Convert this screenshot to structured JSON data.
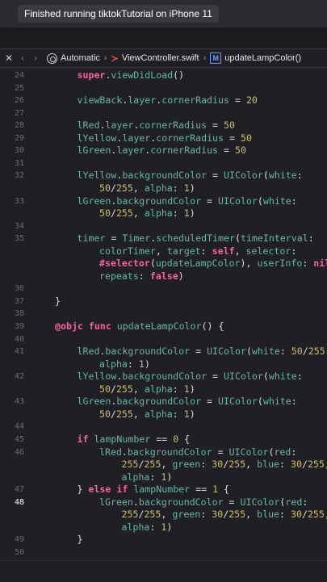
{
  "status": {
    "message": "Finished running tiktokTutorial on iPhone 11"
  },
  "jumpbar": {
    "close_glyph": "✕",
    "back_glyph": "‹",
    "forward_glyph": "›",
    "scheme": "Automatic",
    "file": "ViewController.swift",
    "method_badge": "M",
    "method": "updateLampColor()",
    "sep": "›"
  },
  "editor": {
    "current_line": 48,
    "lines": [
      {
        "n": "24",
        "indent": 2,
        "tokens": [
          [
            "kw",
            "super"
          ],
          [
            "plain",
            "."
          ],
          [
            "prop",
            "viewDidLoad"
          ],
          [
            "plain",
            "()"
          ]
        ]
      },
      {
        "n": "25",
        "indent": 2,
        "tokens": []
      },
      {
        "n": "26",
        "indent": 2,
        "tokens": [
          [
            "prop",
            "viewBack"
          ],
          [
            "plain",
            "."
          ],
          [
            "prop",
            "layer"
          ],
          [
            "plain",
            "."
          ],
          [
            "prop",
            "cornerRadius"
          ],
          [
            "plain",
            " = "
          ],
          [
            "num",
            "20"
          ]
        ]
      },
      {
        "n": "27",
        "indent": 2,
        "tokens": []
      },
      {
        "n": "28",
        "indent": 2,
        "tokens": [
          [
            "prop",
            "lRed"
          ],
          [
            "plain",
            "."
          ],
          [
            "prop",
            "layer"
          ],
          [
            "plain",
            "."
          ],
          [
            "prop",
            "cornerRadius"
          ],
          [
            "plain",
            " = "
          ],
          [
            "num",
            "50"
          ]
        ]
      },
      {
        "n": "29",
        "indent": 2,
        "tokens": [
          [
            "prop",
            "lYellow"
          ],
          [
            "plain",
            "."
          ],
          [
            "prop",
            "layer"
          ],
          [
            "plain",
            "."
          ],
          [
            "prop",
            "cornerRadius"
          ],
          [
            "plain",
            " = "
          ],
          [
            "num",
            "50"
          ]
        ]
      },
      {
        "n": "30",
        "indent": 2,
        "tokens": [
          [
            "prop",
            "lGreen"
          ],
          [
            "plain",
            "."
          ],
          [
            "prop",
            "layer"
          ],
          [
            "plain",
            "."
          ],
          [
            "prop",
            "cornerRadius"
          ],
          [
            "plain",
            " = "
          ],
          [
            "num",
            "50"
          ]
        ]
      },
      {
        "n": "31",
        "indent": 2,
        "tokens": []
      },
      {
        "n": "32",
        "indent": 2,
        "tokens": [
          [
            "prop",
            "lYellow"
          ],
          [
            "plain",
            "."
          ],
          [
            "prop",
            "backgroundColor"
          ],
          [
            "plain",
            " = "
          ],
          [
            "prop",
            "UIColor"
          ],
          [
            "plain",
            "("
          ],
          [
            "prop",
            "white"
          ],
          [
            "plain",
            ":"
          ]
        ]
      },
      {
        "n": "",
        "indent": 3,
        "tokens": [
          [
            "num",
            "50"
          ],
          [
            "plain",
            "/"
          ],
          [
            "num",
            "255"
          ],
          [
            "plain",
            ", "
          ],
          [
            "prop",
            "alpha"
          ],
          [
            "plain",
            ": "
          ],
          [
            "num",
            "1"
          ],
          [
            "plain",
            ")"
          ]
        ]
      },
      {
        "n": "33",
        "indent": 2,
        "tokens": [
          [
            "prop",
            "lGreen"
          ],
          [
            "plain",
            "."
          ],
          [
            "prop",
            "backgroundColor"
          ],
          [
            "plain",
            " = "
          ],
          [
            "prop",
            "UIColor"
          ],
          [
            "plain",
            "("
          ],
          [
            "prop",
            "white"
          ],
          [
            "plain",
            ":"
          ]
        ]
      },
      {
        "n": "",
        "indent": 3,
        "tokens": [
          [
            "num",
            "50"
          ],
          [
            "plain",
            "/"
          ],
          [
            "num",
            "255"
          ],
          [
            "plain",
            ", "
          ],
          [
            "prop",
            "alpha"
          ],
          [
            "plain",
            ": "
          ],
          [
            "num",
            "1"
          ],
          [
            "plain",
            ")"
          ]
        ]
      },
      {
        "n": "34",
        "indent": 2,
        "tokens": []
      },
      {
        "n": "35",
        "indent": 2,
        "tokens": [
          [
            "prop",
            "timer"
          ],
          [
            "plain",
            " = "
          ],
          [
            "prop",
            "Timer"
          ],
          [
            "plain",
            "."
          ],
          [
            "prop",
            "scheduledTimer"
          ],
          [
            "plain",
            "("
          ],
          [
            "prop",
            "timeInterval"
          ],
          [
            "plain",
            ":"
          ]
        ]
      },
      {
        "n": "",
        "indent": 3,
        "tokens": [
          [
            "prop",
            "colorTimer"
          ],
          [
            "plain",
            ", "
          ],
          [
            "prop",
            "target"
          ],
          [
            "plain",
            ": "
          ],
          [
            "kw",
            "self"
          ],
          [
            "plain",
            ", "
          ],
          [
            "prop",
            "selector"
          ],
          [
            "plain",
            ":"
          ]
        ]
      },
      {
        "n": "",
        "indent": 3,
        "tokens": [
          [
            "kw",
            "#selector"
          ],
          [
            "plain",
            "("
          ],
          [
            "prop",
            "updateLampColor"
          ],
          [
            "plain",
            "), "
          ],
          [
            "prop",
            "userInfo"
          ],
          [
            "plain",
            ": "
          ],
          [
            "kw",
            "nil"
          ],
          [
            "plain",
            ","
          ]
        ]
      },
      {
        "n": "",
        "indent": 3,
        "tokens": [
          [
            "prop",
            "repeats"
          ],
          [
            "plain",
            ": "
          ],
          [
            "kw",
            "false"
          ],
          [
            "plain",
            ")"
          ]
        ]
      },
      {
        "n": "36",
        "indent": 2,
        "tokens": []
      },
      {
        "n": "37",
        "indent": 1,
        "tokens": [
          [
            "plain",
            "}"
          ]
        ]
      },
      {
        "n": "38",
        "indent": 1,
        "tokens": []
      },
      {
        "n": "39",
        "indent": 1,
        "tokens": [
          [
            "kw",
            "@objc"
          ],
          [
            "plain",
            " "
          ],
          [
            "kw",
            "func"
          ],
          [
            "plain",
            " "
          ],
          [
            "prop",
            "updateLampColor"
          ],
          [
            "plain",
            "() {"
          ]
        ]
      },
      {
        "n": "40",
        "indent": 2,
        "tokens": []
      },
      {
        "n": "41",
        "indent": 2,
        "tokens": [
          [
            "prop",
            "lRed"
          ],
          [
            "plain",
            "."
          ],
          [
            "prop",
            "backgroundColor"
          ],
          [
            "plain",
            " = "
          ],
          [
            "prop",
            "UIColor"
          ],
          [
            "plain",
            "("
          ],
          [
            "prop",
            "white"
          ],
          [
            "plain",
            ": "
          ],
          [
            "num",
            "50"
          ],
          [
            "plain",
            "/"
          ],
          [
            "num",
            "255"
          ],
          [
            "plain",
            ","
          ]
        ]
      },
      {
        "n": "",
        "indent": 3,
        "tokens": [
          [
            "prop",
            "alpha"
          ],
          [
            "plain",
            ": "
          ],
          [
            "num",
            "1"
          ],
          [
            "plain",
            ")"
          ]
        ]
      },
      {
        "n": "42",
        "indent": 2,
        "tokens": [
          [
            "prop",
            "lYellow"
          ],
          [
            "plain",
            "."
          ],
          [
            "prop",
            "backgroundColor"
          ],
          [
            "plain",
            " = "
          ],
          [
            "prop",
            "UIColor"
          ],
          [
            "plain",
            "("
          ],
          [
            "prop",
            "white"
          ],
          [
            "plain",
            ":"
          ]
        ]
      },
      {
        "n": "",
        "indent": 3,
        "tokens": [
          [
            "num",
            "50"
          ],
          [
            "plain",
            "/"
          ],
          [
            "num",
            "255"
          ],
          [
            "plain",
            ", "
          ],
          [
            "prop",
            "alpha"
          ],
          [
            "plain",
            ": "
          ],
          [
            "num",
            "1"
          ],
          [
            "plain",
            ")"
          ]
        ]
      },
      {
        "n": "43",
        "indent": 2,
        "tokens": [
          [
            "prop",
            "lGreen"
          ],
          [
            "plain",
            "."
          ],
          [
            "prop",
            "backgroundColor"
          ],
          [
            "plain",
            " = "
          ],
          [
            "prop",
            "UIColor"
          ],
          [
            "plain",
            "("
          ],
          [
            "prop",
            "white"
          ],
          [
            "plain",
            ":"
          ]
        ]
      },
      {
        "n": "",
        "indent": 3,
        "tokens": [
          [
            "num",
            "50"
          ],
          [
            "plain",
            "/"
          ],
          [
            "num",
            "255"
          ],
          [
            "plain",
            ", "
          ],
          [
            "prop",
            "alpha"
          ],
          [
            "plain",
            ": "
          ],
          [
            "num",
            "1"
          ],
          [
            "plain",
            ")"
          ]
        ]
      },
      {
        "n": "44",
        "indent": 2,
        "tokens": []
      },
      {
        "n": "45",
        "indent": 2,
        "tokens": [
          [
            "kw",
            "if"
          ],
          [
            "plain",
            " "
          ],
          [
            "prop",
            "lampNumber"
          ],
          [
            "plain",
            " == "
          ],
          [
            "num",
            "0"
          ],
          [
            "plain",
            " {"
          ]
        ]
      },
      {
        "n": "46",
        "indent": 3,
        "tokens": [
          [
            "prop",
            "lRed"
          ],
          [
            "plain",
            "."
          ],
          [
            "prop",
            "backgroundColor"
          ],
          [
            "plain",
            " = "
          ],
          [
            "prop",
            "UIColor"
          ],
          [
            "plain",
            "("
          ],
          [
            "prop",
            "red"
          ],
          [
            "plain",
            ":"
          ]
        ]
      },
      {
        "n": "",
        "indent": 4,
        "tokens": [
          [
            "num",
            "255"
          ],
          [
            "plain",
            "/"
          ],
          [
            "num",
            "255"
          ],
          [
            "plain",
            ", "
          ],
          [
            "prop",
            "green"
          ],
          [
            "plain",
            ": "
          ],
          [
            "num",
            "30"
          ],
          [
            "plain",
            "/"
          ],
          [
            "num",
            "255"
          ],
          [
            "plain",
            ", "
          ],
          [
            "prop",
            "blue"
          ],
          [
            "plain",
            ": "
          ],
          [
            "num",
            "30"
          ],
          [
            "plain",
            "/"
          ],
          [
            "num",
            "255"
          ],
          [
            "plain",
            ","
          ]
        ]
      },
      {
        "n": "",
        "indent": 4,
        "tokens": [
          [
            "prop",
            "alpha"
          ],
          [
            "plain",
            ": "
          ],
          [
            "num",
            "1"
          ],
          [
            "plain",
            ")"
          ]
        ]
      },
      {
        "n": "47",
        "indent": 2,
        "tokens": [
          [
            "plain",
            "} "
          ],
          [
            "kw",
            "else"
          ],
          [
            "plain",
            " "
          ],
          [
            "kw",
            "if"
          ],
          [
            "plain",
            " "
          ],
          [
            "prop",
            "lampNumber"
          ],
          [
            "plain",
            " == "
          ],
          [
            "num",
            "1"
          ],
          [
            "plain",
            " {"
          ]
        ]
      },
      {
        "n": "48",
        "indent": 3,
        "tokens": [
          [
            "prop",
            "lGreen"
          ],
          [
            "plain",
            "."
          ],
          [
            "prop",
            "backgroundColor"
          ],
          [
            "plain",
            " = "
          ],
          [
            "prop",
            "UIColor"
          ],
          [
            "plain",
            "("
          ],
          [
            "prop",
            "red"
          ],
          [
            "plain",
            ":"
          ]
        ]
      },
      {
        "n": "",
        "indent": 4,
        "tokens": [
          [
            "num",
            "255"
          ],
          [
            "plain",
            "/"
          ],
          [
            "num",
            "255"
          ],
          [
            "plain",
            ", "
          ],
          [
            "prop",
            "green"
          ],
          [
            "plain",
            ": "
          ],
          [
            "num",
            "30"
          ],
          [
            "plain",
            "/"
          ],
          [
            "num",
            "255"
          ],
          [
            "plain",
            ", "
          ],
          [
            "prop",
            "blue"
          ],
          [
            "plain",
            ": "
          ],
          [
            "num",
            "30"
          ],
          [
            "plain",
            "/"
          ],
          [
            "num",
            "255"
          ],
          [
            "plain",
            ","
          ]
        ]
      },
      {
        "n": "",
        "indent": 4,
        "tokens": [
          [
            "prop",
            "alpha"
          ],
          [
            "plain",
            ": "
          ],
          [
            "num",
            "1"
          ],
          [
            "plain",
            ")"
          ]
        ]
      },
      {
        "n": "49",
        "indent": 2,
        "tokens": [
          [
            "plain",
            "}"
          ]
        ]
      },
      {
        "n": "50",
        "indent": 2,
        "tokens": []
      }
    ]
  }
}
